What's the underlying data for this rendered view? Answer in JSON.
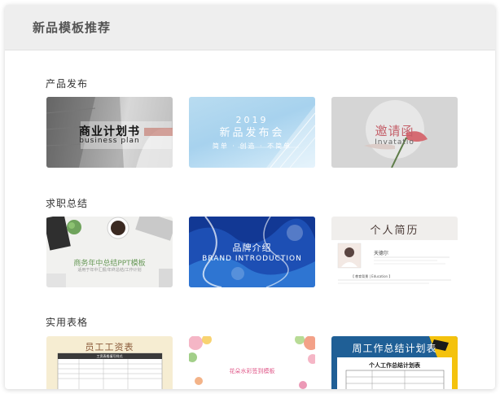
{
  "panel": {
    "title": "新品模板推荐"
  },
  "sections": [
    {
      "title": "产品发布",
      "cards": [
        {
          "title": "商业计划书",
          "subtitle": "business plan"
        },
        {
          "year": "2019",
          "title": "新品发布会",
          "subtitle": "简单 · 创造 · 不简单"
        },
        {
          "title": "邀请函",
          "subtitle": "Invatatio"
        }
      ]
    },
    {
      "title": "求职总结",
      "cards": [
        {
          "title": "商务年中总结PPT模板",
          "subtitle": "适用于年中汇报/年终总结/工作计划"
        },
        {
          "title": "品牌介绍",
          "subtitle": "BRAND INTRODUCTION"
        },
        {
          "title": "个人简历",
          "name": "天德尔",
          "section": "【 教育背景 | Education 】"
        }
      ]
    },
    {
      "title": "实用表格",
      "cards": [
        {
          "title": "员工工资表",
          "subtitle": "工资表格填写样式"
        },
        {
          "title": "花朵水彩签到模板"
        },
        {
          "title": "周工作总结计划表",
          "subtitle": "个人工作总结计划表"
        }
      ]
    }
  ],
  "colors": {
    "header_bg": "#eeeeee",
    "accent_blue": "#1d4fb4",
    "accent_rose": "#c4606a"
  }
}
